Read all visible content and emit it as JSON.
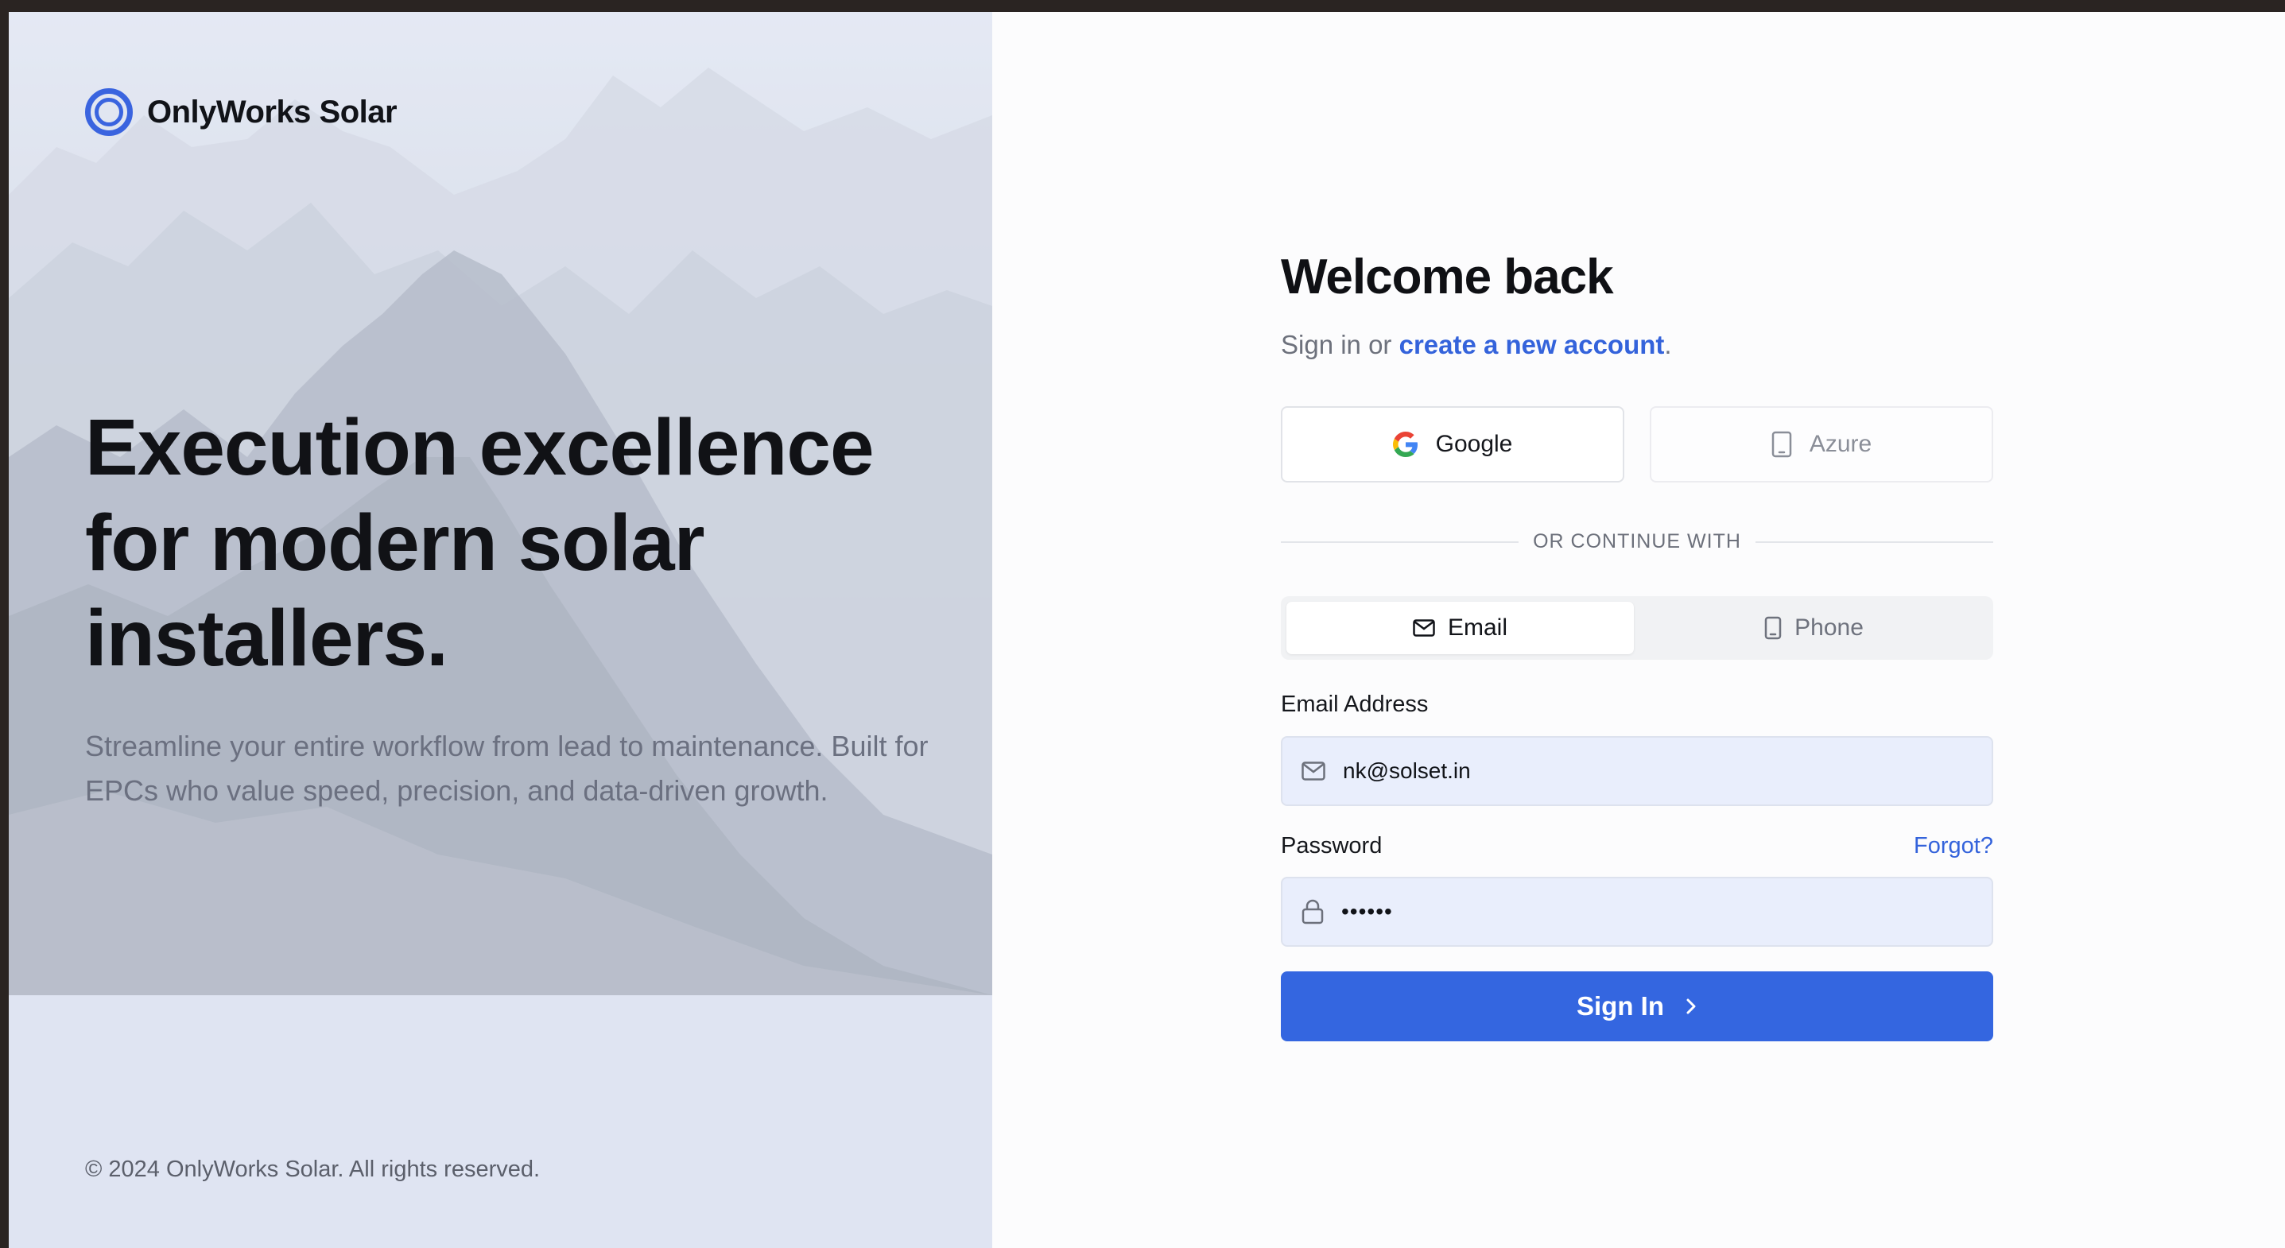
{
  "brand": {
    "name": "OnlyWorks Solar",
    "accent": "#3a64df"
  },
  "hero": {
    "headline": "Execution excellence for modern solar installers.",
    "subline": "Streamline your entire workflow from lead to maintenance. Built for EPCs who value speed, precision, and data-driven growth.",
    "copyright": "© 2024 OnlyWorks Solar. All rights reserved."
  },
  "form": {
    "title": "Welcome back",
    "signin_prefix": "Sign in or ",
    "create_account_link": "create a new account",
    "signin_suffix": ".",
    "sso": {
      "google_label": "Google",
      "azure_label": "Azure"
    },
    "divider_text": "OR CONTINUE WITH",
    "tabs": {
      "email_label": "Email",
      "phone_label": "Phone",
      "active": "Email"
    },
    "email": {
      "label": "Email Address",
      "value": "nk@solset.in"
    },
    "password": {
      "label": "Password",
      "forgot_label": "Forgot?",
      "value": "••••••"
    },
    "submit_label": "Sign In",
    "primary_color": "#3466e0"
  }
}
